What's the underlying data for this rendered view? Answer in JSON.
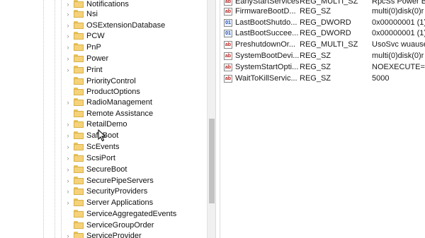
{
  "tree": {
    "items": [
      {
        "label": "Notifications"
      },
      {
        "label": "Nsi"
      },
      {
        "label": "OSExtensionDatabase"
      },
      {
        "label": "PCW"
      },
      {
        "label": "PnP"
      },
      {
        "label": "Power"
      },
      {
        "label": "Print"
      },
      {
        "label": "PriorityControl"
      },
      {
        "label": "ProductOptions"
      },
      {
        "label": "RadioManagement"
      },
      {
        "label": "Remote Assistance"
      },
      {
        "label": "RetailDemo"
      },
      {
        "label": "SafeBoot"
      },
      {
        "label": "ScEvents"
      },
      {
        "label": "ScsiPort"
      },
      {
        "label": "SecureBoot"
      },
      {
        "label": "SecurePipeServers"
      },
      {
        "label": "SecurityProviders"
      },
      {
        "label": "Server Applications"
      },
      {
        "label": "ServiceAggregatedEvents"
      },
      {
        "label": "ServiceGroupOrder"
      },
      {
        "label": "ServiceProvider"
      }
    ]
  },
  "values": {
    "rows": [
      {
        "icon": "string-value-icon",
        "name": "EarlyStartServices",
        "type": "REG_MULTI_SZ",
        "data": "RpcSs Power Br"
      },
      {
        "icon": "string-value-icon",
        "name": "FirmwareBootD...",
        "type": "REG_SZ",
        "data": "multi(0)disk(0)r"
      },
      {
        "icon": "dword-value-icon",
        "name": "LastBootShutdo...",
        "type": "REG_DWORD",
        "data": "0x00000001 (1)"
      },
      {
        "icon": "dword-value-icon",
        "name": "LastBootSuccee...",
        "type": "REG_DWORD",
        "data": "0x00000001 (1)"
      },
      {
        "icon": "string-value-icon",
        "name": "PreshutdownOr...",
        "type": "REG_MULTI_SZ",
        "data": "UsoSvc wuauser"
      },
      {
        "icon": "string-value-icon",
        "name": "SystemBootDevi...",
        "type": "REG_SZ",
        "data": "multi(0)disk(0)r"
      },
      {
        "icon": "string-value-icon",
        "name": "SystemStartOpti...",
        "type": "REG_SZ",
        "data": " NOEXECUTE=O"
      },
      {
        "icon": "string-value-icon",
        "name": "WaitToKillServic...",
        "type": "REG_SZ",
        "data": "5000"
      }
    ]
  }
}
